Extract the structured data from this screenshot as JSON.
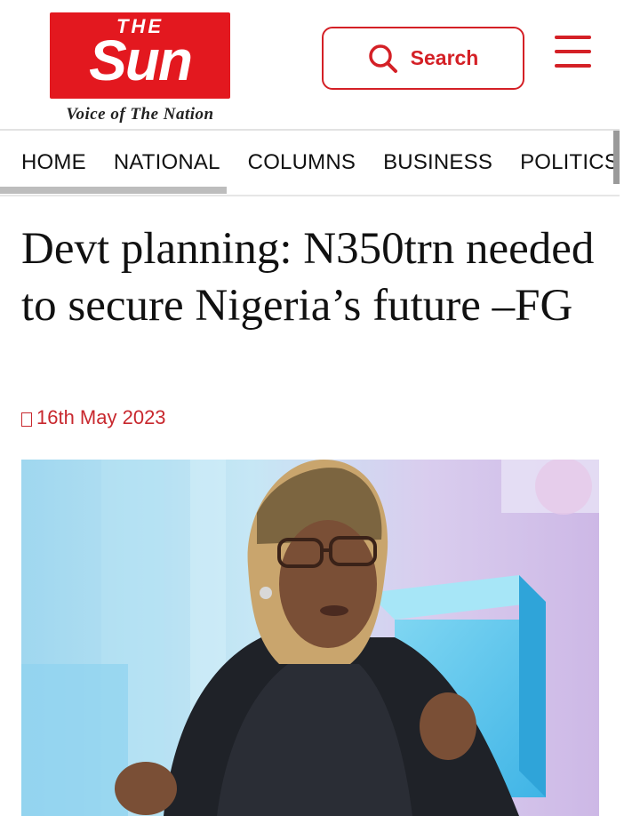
{
  "header": {
    "logo": {
      "the": "THE",
      "name": "Sun",
      "tagline": "Voice of The Nation"
    },
    "search_label": "Search"
  },
  "nav": {
    "items": [
      "HOME",
      "NATIONAL",
      "COLUMNS",
      "BUSINESS",
      "POLITICS"
    ]
  },
  "article": {
    "headline": "Devt planning: N350trn needed to secure Nigeria’s future –FG",
    "date": "16th May 2023"
  },
  "colors": {
    "brand_red": "#e3181f",
    "accent_red": "#d42026",
    "date_red": "#c8282e"
  },
  "icons": {
    "search": "search-icon",
    "menu": "hamburger-menu-icon",
    "date": "clock-icon"
  }
}
